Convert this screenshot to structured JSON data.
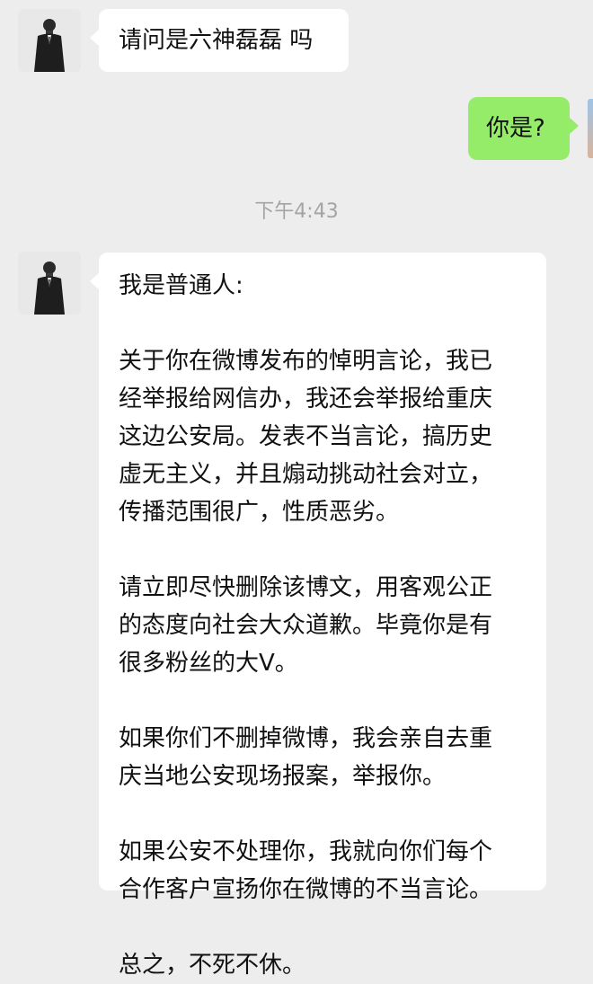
{
  "messages": [
    {
      "sender": "contact",
      "text": "请问是六神磊磊 吗"
    },
    {
      "sender": "me",
      "text": "你是?"
    },
    {
      "sender": "contact",
      "paragraphs": [
        [
          "我是普通人:"
        ],
        [
          "关于你在微博发布的悼明言论，我已",
          "经举报给网信办，我还会举报给重庆",
          "这边公安局。发表不当言论，搞历史",
          "虚无主义，并且煽动挑动社会对立，",
          "传播范围很广，性质恶劣。"
        ],
        [
          "请立即尽快删除该博文，用客观公正",
          "的态度向社会大众道歉。毕竟你是有",
          "很多粉丝的大V。"
        ],
        [
          "如果你们不删掉微博，我会亲自去重",
          "庆当地公安现场报案，举报你。"
        ],
        [
          "如果公安不处理你，我就向你们每个",
          "合作客户宣扬你在微博的不当言论。"
        ],
        [
          "总之，不死不休。"
        ]
      ]
    }
  ],
  "timestamp": "下午4:43",
  "colors": {
    "chat_background": "#ededed",
    "incoming_bubble": "#ffffff",
    "outgoing_bubble": "#95ec69",
    "timestamp_text": "#a4a4a4"
  },
  "icons": {
    "contact_avatar": "avatar-man-in-suit-icon"
  }
}
